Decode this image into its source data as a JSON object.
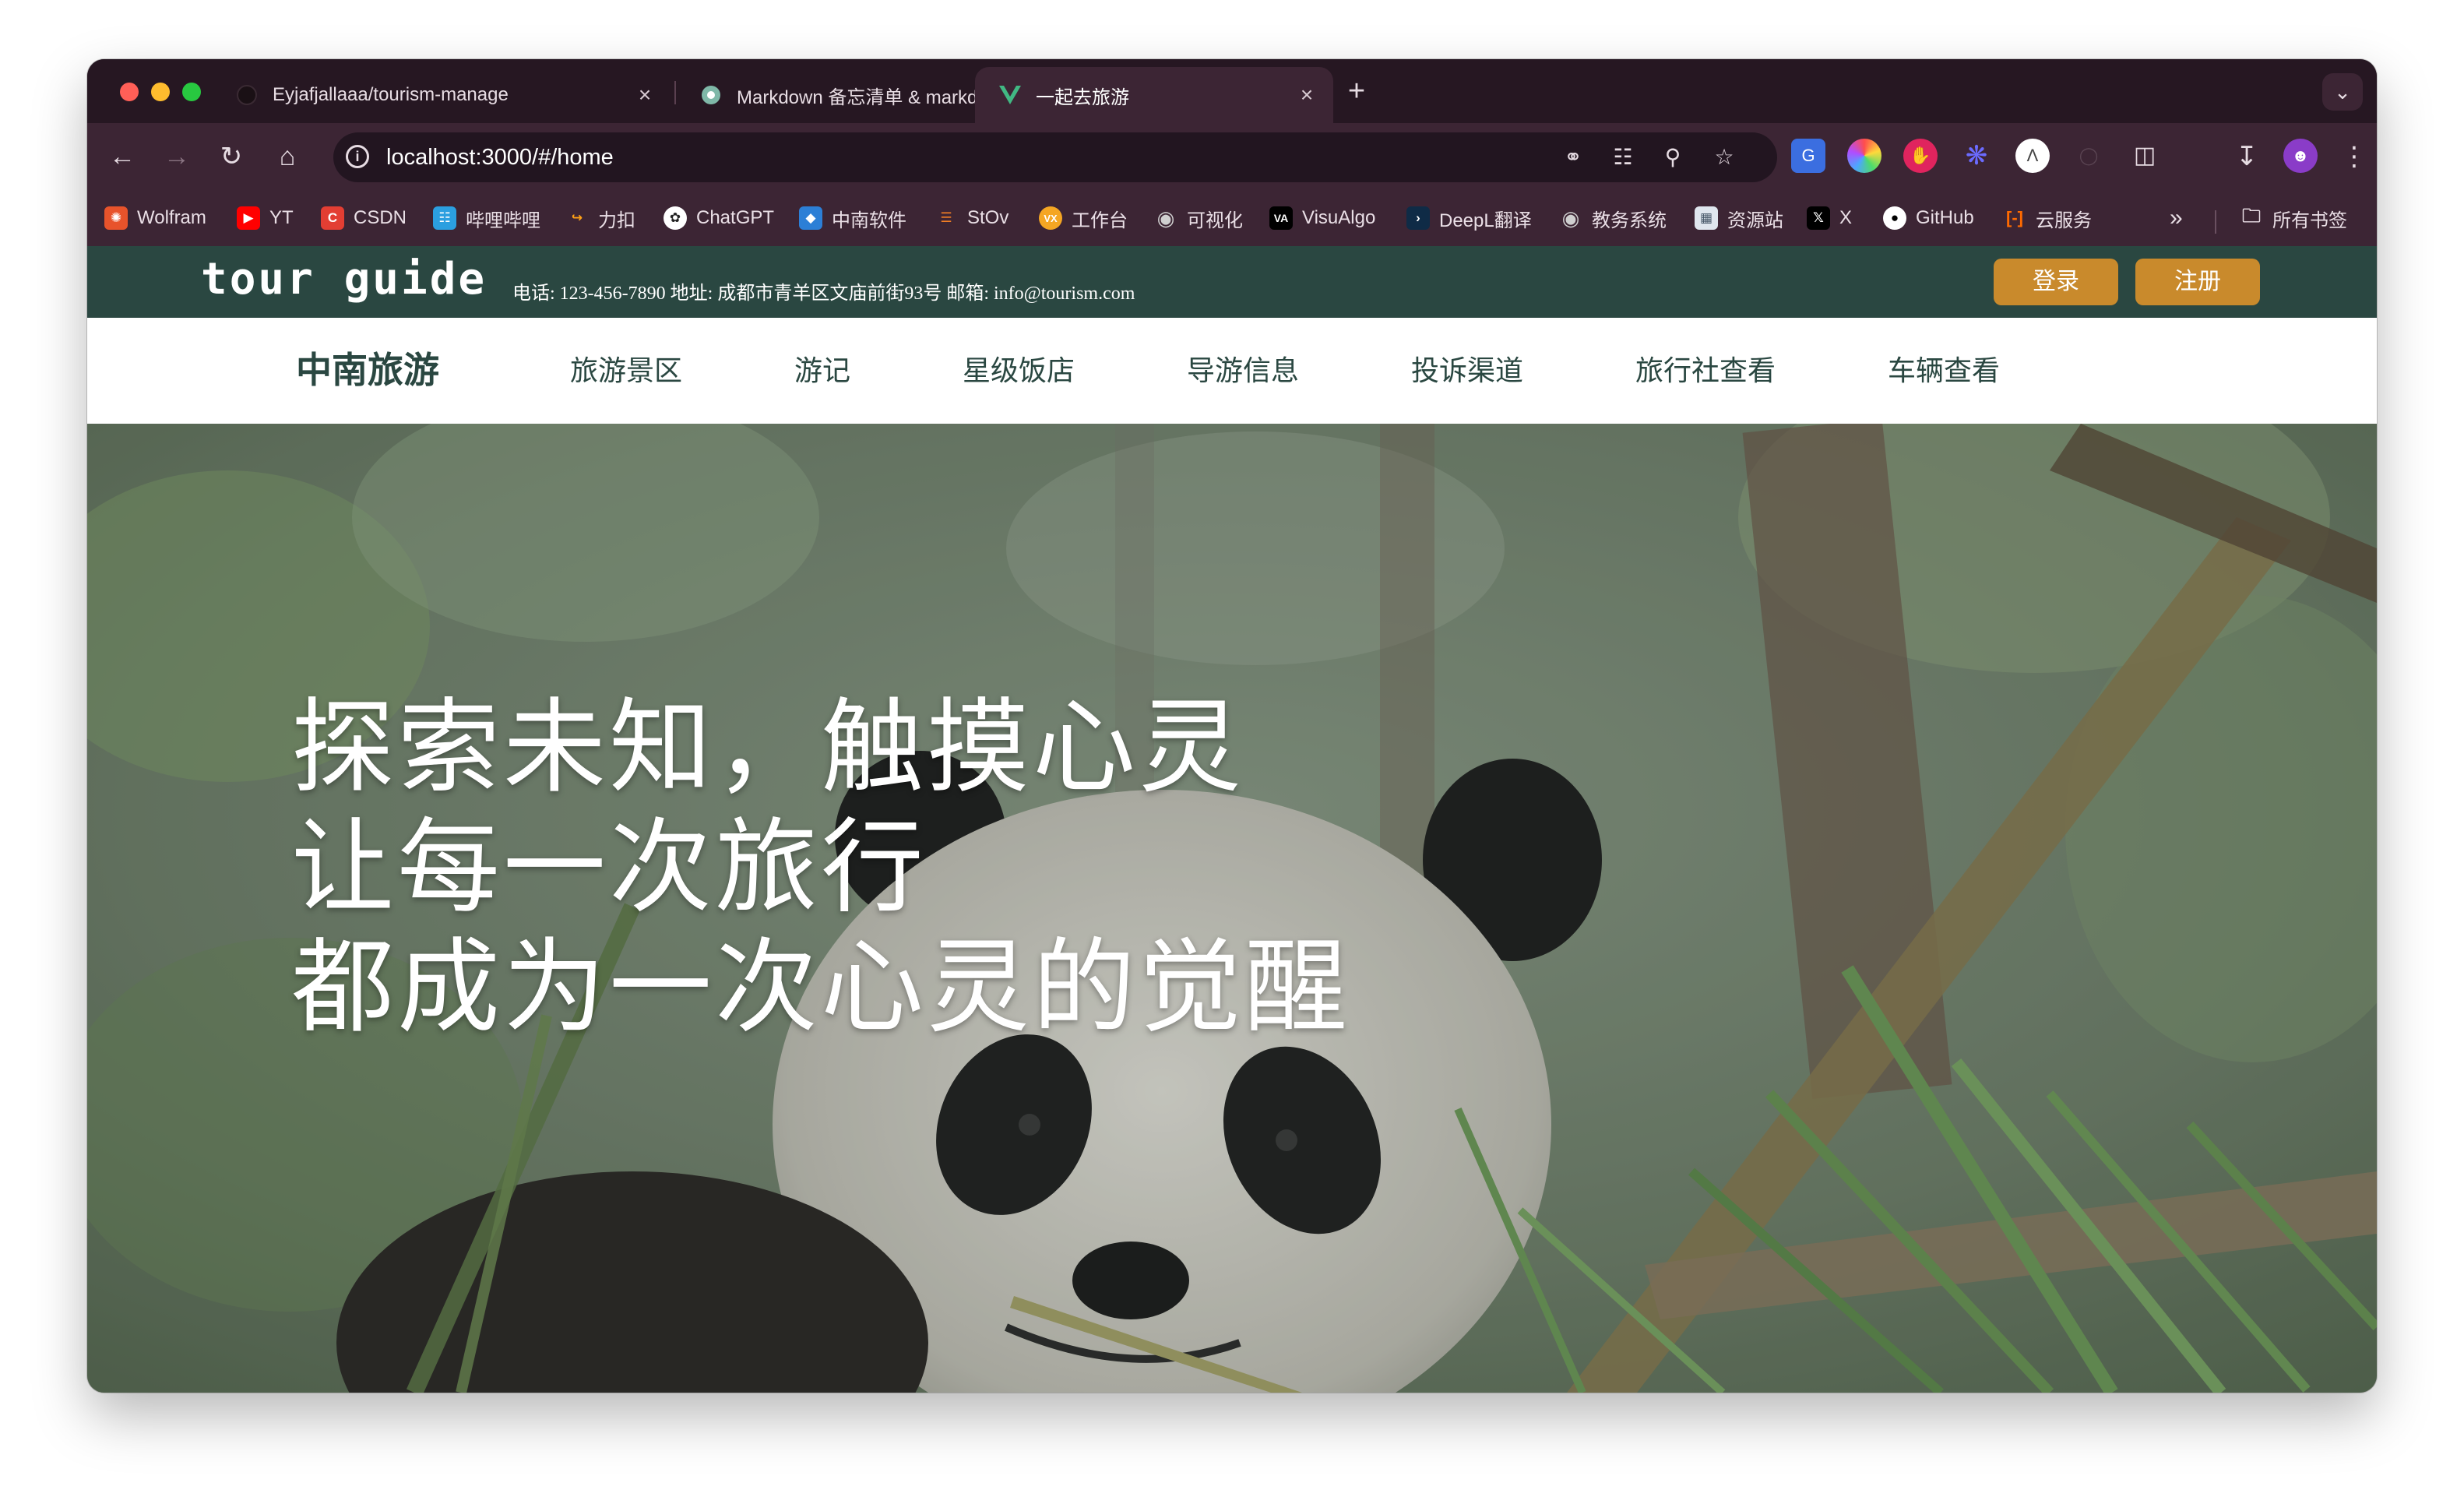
{
  "browser": {
    "tabs": [
      {
        "title": "Eyjafjallaaa/tourism-manage",
        "icon": "github-icon"
      },
      {
        "title": "Markdown 备忘清单 & markdo",
        "icon": "markdown-icon"
      },
      {
        "title": "一起去旅游",
        "icon": "vue-icon"
      }
    ],
    "close_glyph": "×",
    "new_tab_glyph": "+",
    "url": "localhost:3000/#/home",
    "bookmarks": [
      {
        "label": "Wolfram",
        "icon": "wolfram-icon",
        "color": "#e8532b"
      },
      {
        "label": "YT",
        "icon": "youtube-icon",
        "color": "#ff0000"
      },
      {
        "label": "CSDN",
        "icon": "csdn-icon",
        "color": "#e33e33"
      },
      {
        "label": "哔哩哔哩",
        "icon": "bilibili-icon",
        "color": "#2b9fe0"
      },
      {
        "label": "力扣",
        "icon": "leetcode-icon",
        "color": "#ffa116"
      },
      {
        "label": "ChatGPT",
        "icon": "chatgpt-icon",
        "color": "#ffffff"
      },
      {
        "label": "中南软件",
        "icon": "csu-icon",
        "color": "#2c7fd6"
      },
      {
        "label": "StOv",
        "icon": "stackoverflow-icon",
        "color": "#f48024"
      },
      {
        "label": "工作台",
        "icon": "workbench-icon",
        "color": "#f5a623"
      },
      {
        "label": "可视化",
        "icon": "globe-icon",
        "color": "#cfcfcf"
      },
      {
        "label": "VisuAlgo",
        "icon": "visualgo-icon",
        "color": "#000000"
      },
      {
        "label": "DeepL翻译",
        "icon": "deepl-icon",
        "color": "#0f2b46"
      },
      {
        "label": "教务系统",
        "icon": "globe-icon",
        "color": "#cfcfcf"
      },
      {
        "label": "资源站",
        "icon": "resource-icon",
        "color": "#dfe6ee"
      },
      {
        "label": "X",
        "icon": "x-icon",
        "color": "#000000"
      },
      {
        "label": "GitHub",
        "icon": "github-icon",
        "color": "#ffffff"
      },
      {
        "label": "云服务",
        "icon": "cloud-icon",
        "color": "#ff6a00"
      }
    ],
    "all_bookmarks": "所有书签"
  },
  "site": {
    "logo": "tour guide",
    "contact": "电话: 123-456-7890 地址: 成都市青羊区文庙前街93号 邮箱: info@tourism.com",
    "login": "登录",
    "register": "注册",
    "brand": "中南旅游",
    "nav": [
      "旅游景区",
      "游记",
      "星级饭店",
      "导游信息",
      "投诉渠道",
      "旅行社查看",
      "车辆查看"
    ],
    "hero": [
      "探索未知，触摸心灵",
      "让每一次旅行",
      "都成为一次心灵的觉醒"
    ],
    "colors": {
      "header_bg": "#2a4741",
      "button": "#c98a2c",
      "nav_text": "#2a4741"
    }
  }
}
